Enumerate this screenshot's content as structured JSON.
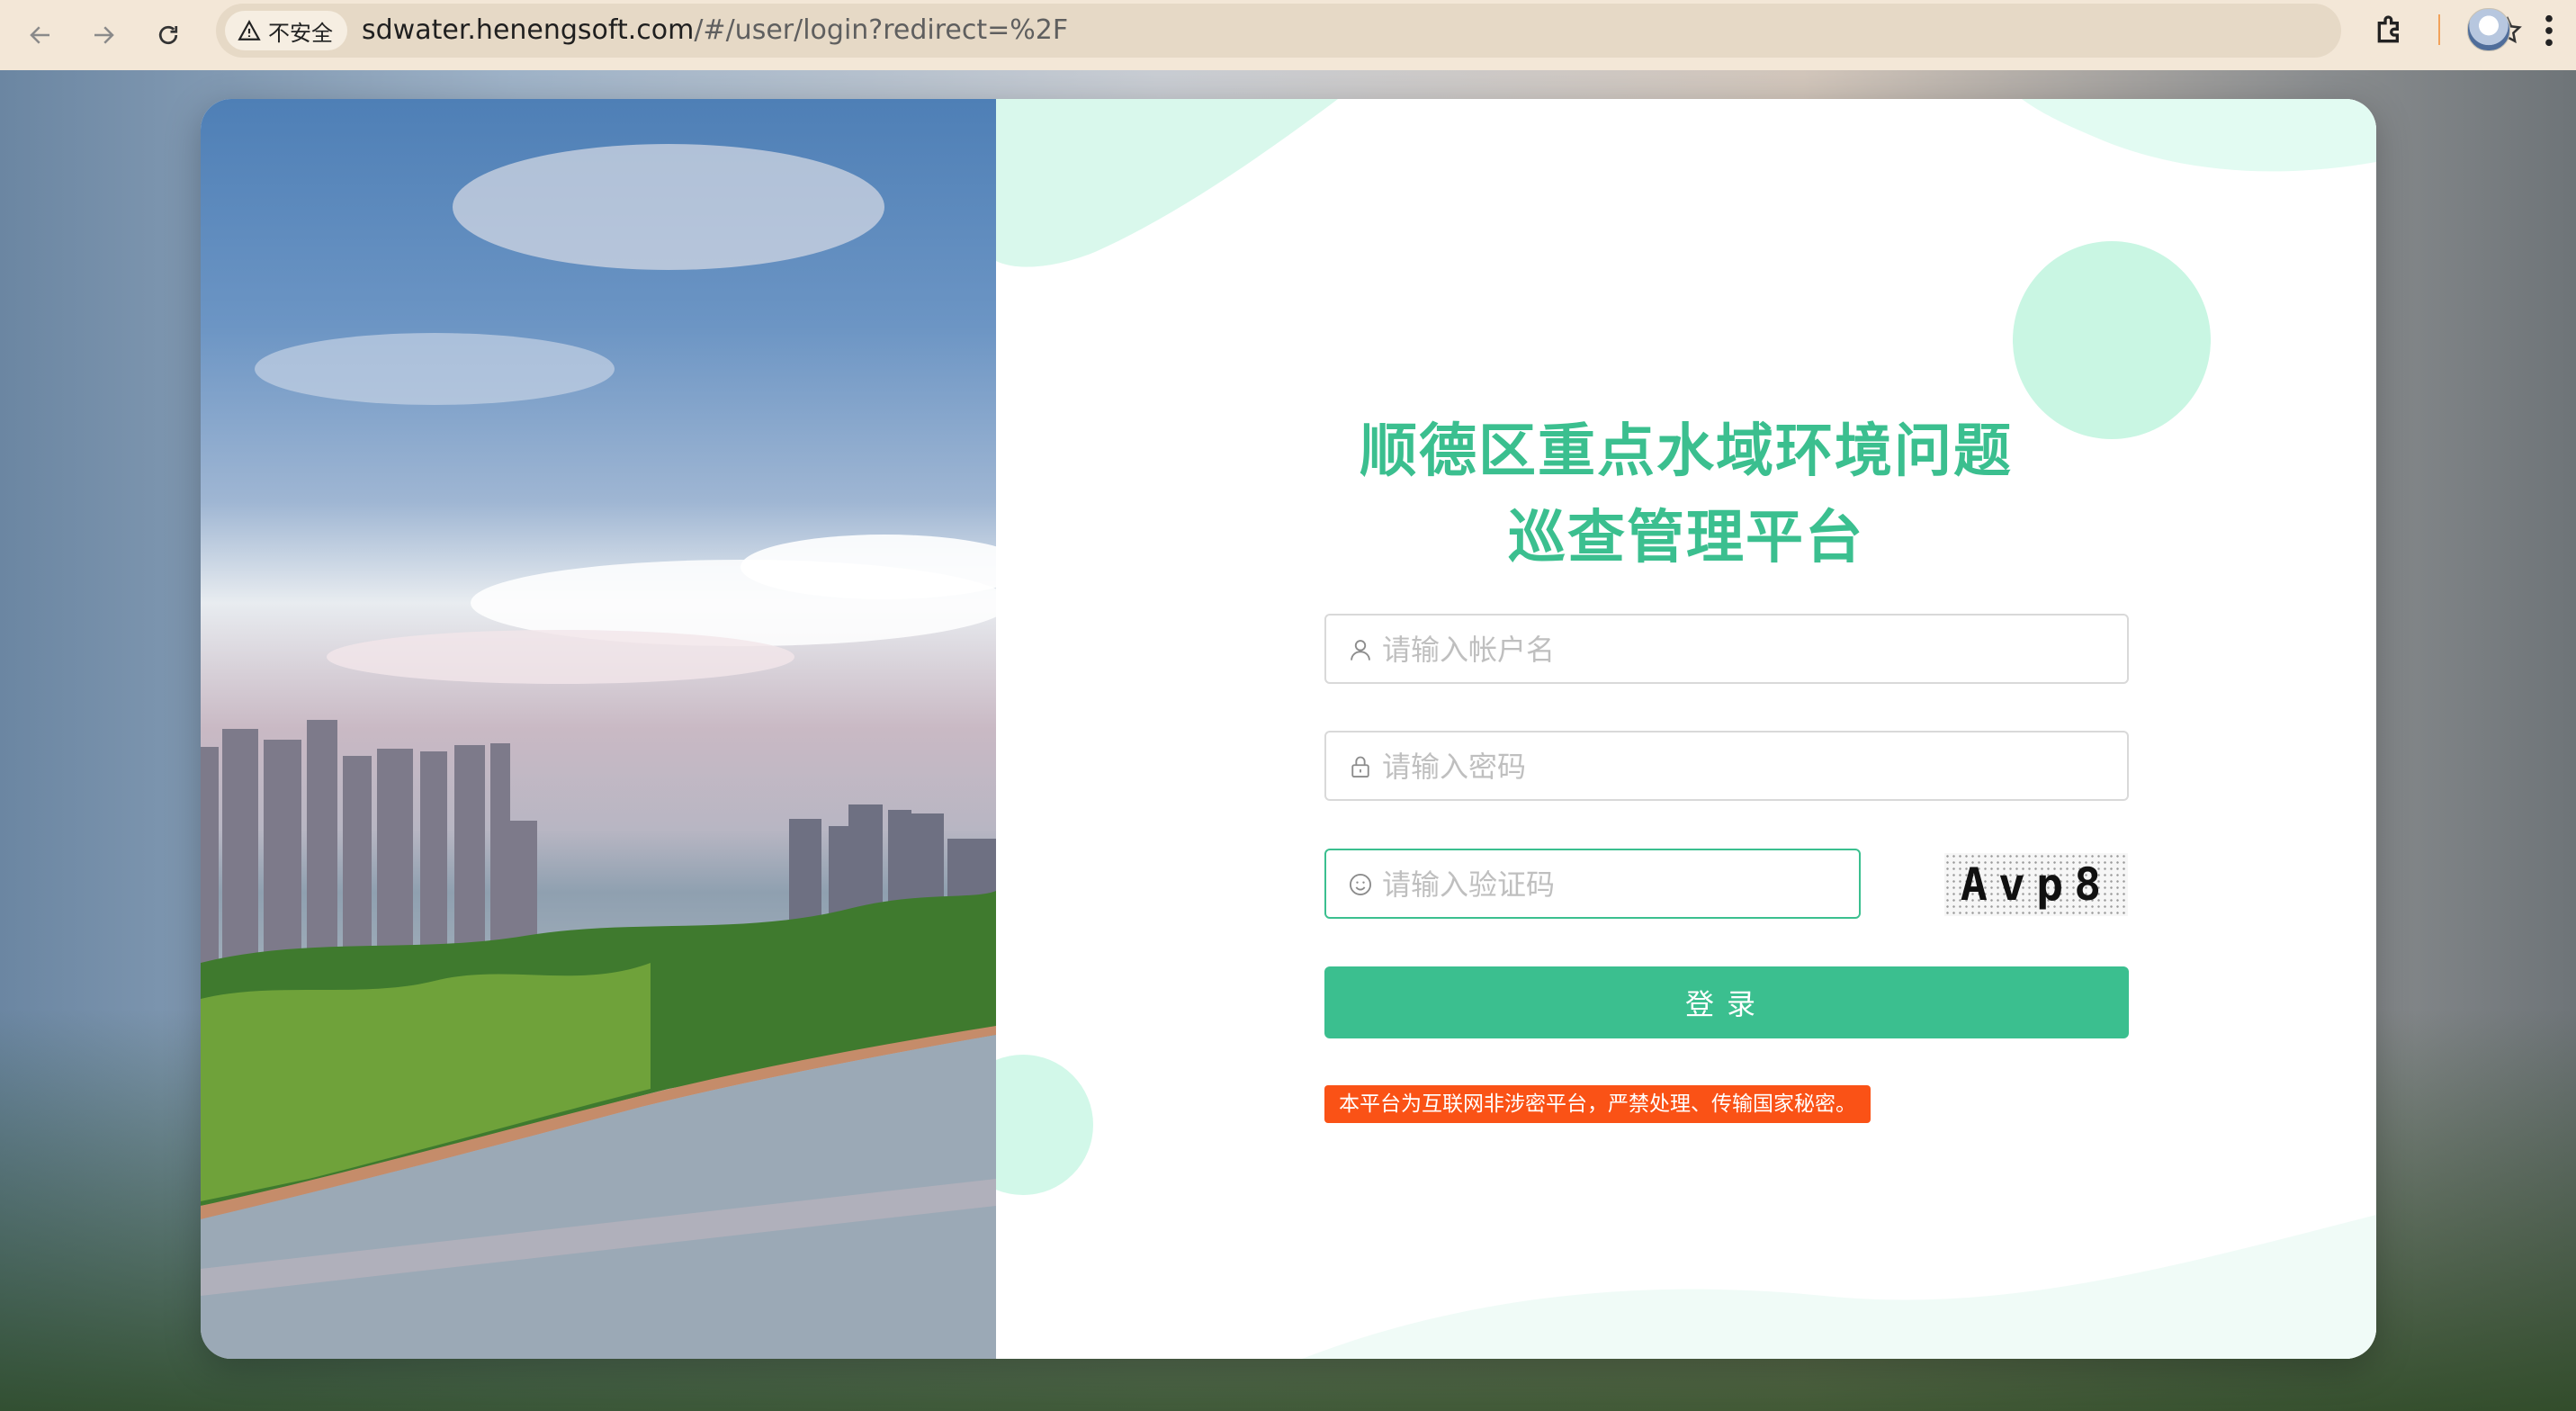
{
  "browser": {
    "security_label": "不安全",
    "url_domain": "sdwater.henengsoft.com",
    "url_path": "/#/user/login?redirect=%2F"
  },
  "login": {
    "title_line1": "顺德区重点水域环境问题",
    "title_line2": "巡查管理平台",
    "username_placeholder": "请输入帐户名",
    "password_placeholder": "请输入密码",
    "captcha_placeholder": "请输入验证码",
    "captcha_text": "Avp8",
    "login_button": "登录",
    "notice": "本平台为互联网非涉密平台，严禁处理、传输国家秘密。"
  },
  "colors": {
    "accent": "#3bbf8f",
    "notice_bg": "#fa5216"
  }
}
